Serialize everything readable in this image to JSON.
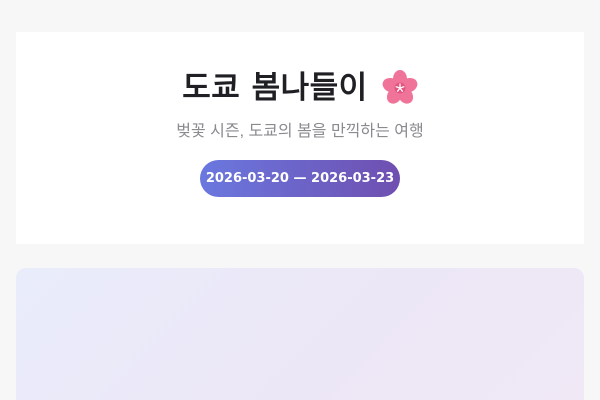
{
  "hero": {
    "title": "도쿄 봄나들이",
    "title_icon": "cherry-blossom-icon",
    "subtitle": "벚꽃 시즌, 도쿄의 봄을 만끽하는 여행",
    "date_range": "2026-03-20 — 2026-03-23"
  },
  "colors": {
    "page_background": "#f7f7f8",
    "card_background": "#ffffff",
    "title_text": "#1f1f24",
    "subtitle_text": "#8a8a8f",
    "pill_gradient_start": "#6a78df",
    "pill_gradient_end": "#6f4fb0",
    "panel_gradient_start": "#e9ecfb",
    "panel_gradient_end": "#f0e8f5",
    "blossom_petal": "#f0749a",
    "blossom_center": "#ffffff"
  }
}
